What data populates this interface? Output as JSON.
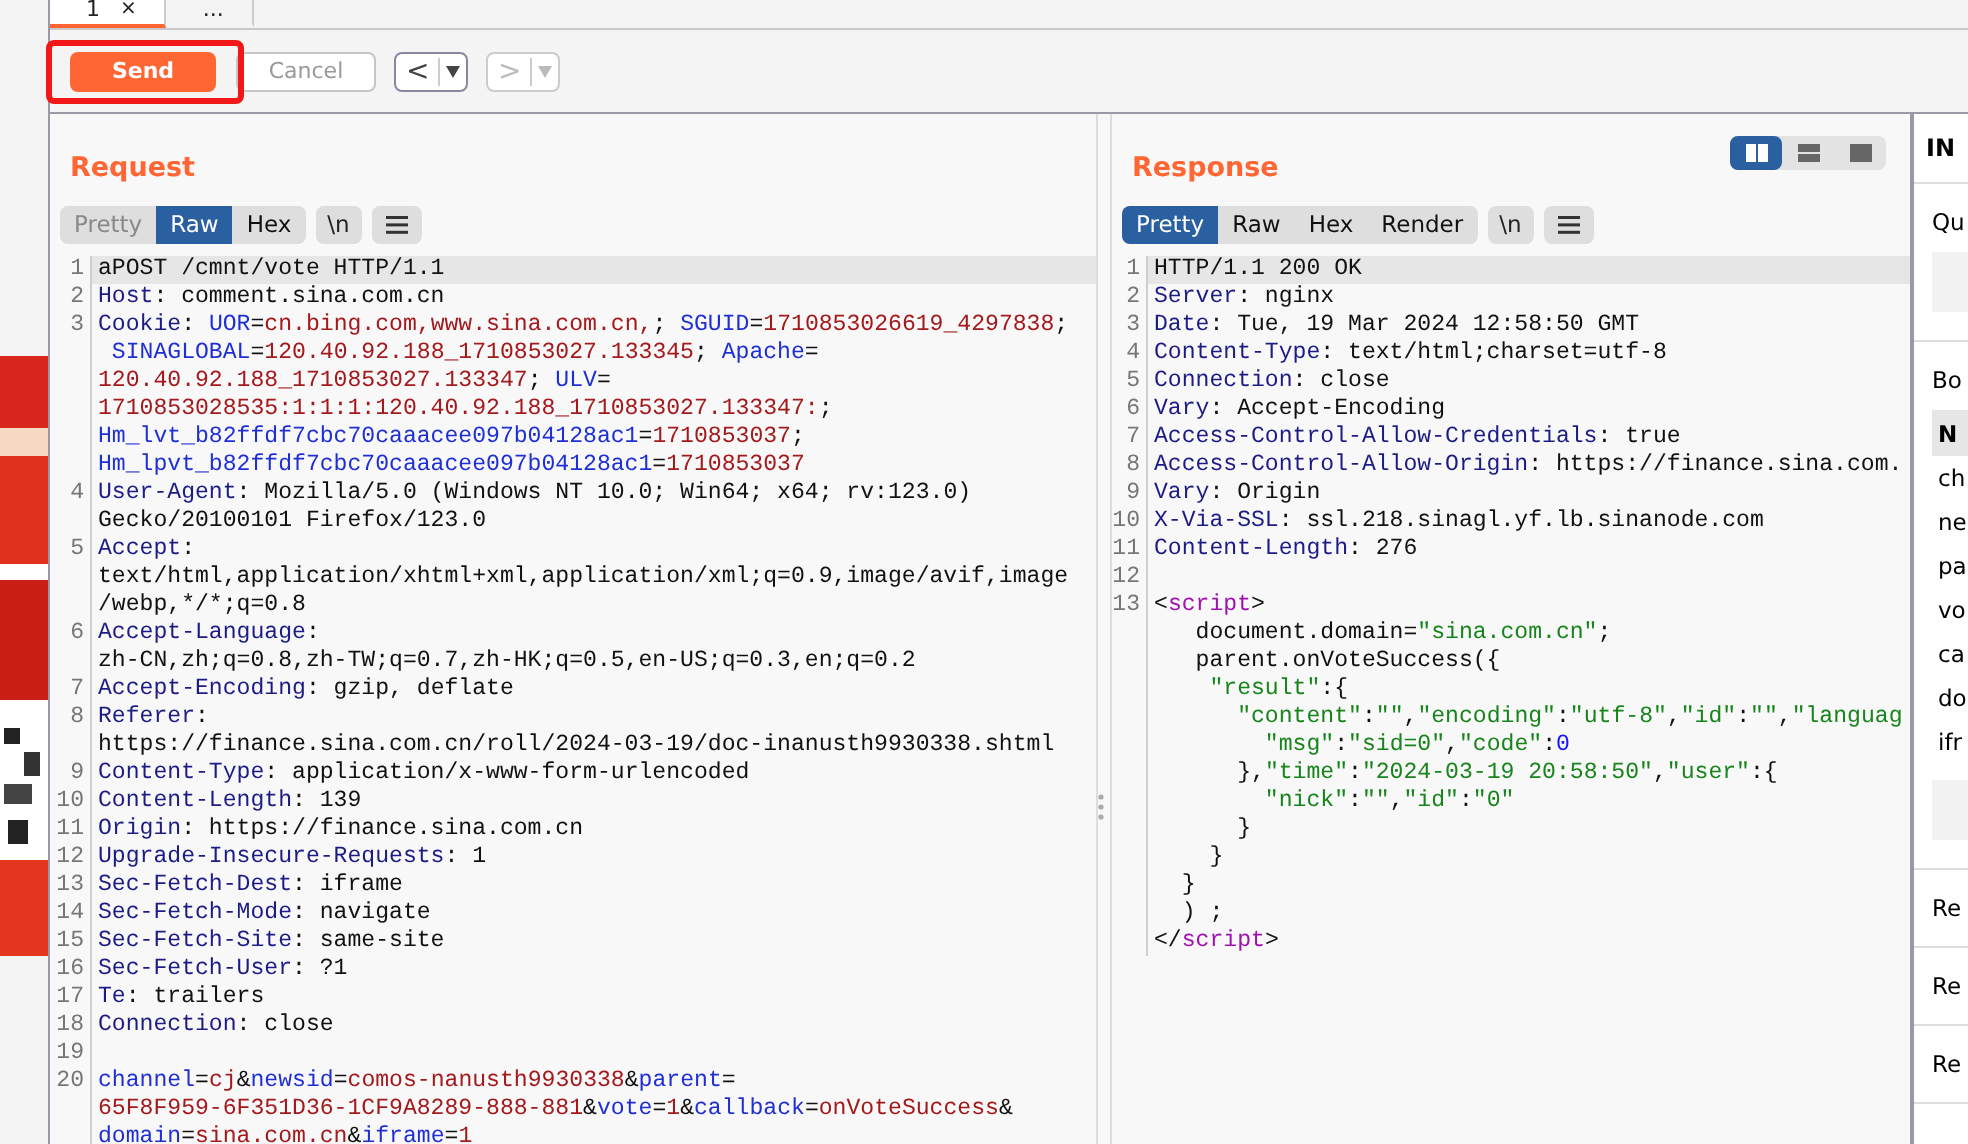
{
  "top_tabs": [
    {
      "label": "1",
      "close": "×",
      "selected": true
    },
    {
      "label": "...",
      "selected": false
    }
  ],
  "toolbar": {
    "send": {
      "label": "Send",
      "highlighted": true
    },
    "cancel": {
      "label": "Cancel",
      "disabled": true
    },
    "back": {
      "label": "<",
      "disabled": false
    },
    "forward": {
      "label": ">",
      "disabled": true
    }
  },
  "request": {
    "title": "Request",
    "view_tabs": [
      {
        "label": "Pretty",
        "selected": false,
        "disabled": true
      },
      {
        "label": "Raw",
        "selected": true,
        "disabled": false
      },
      {
        "label": "Hex",
        "selected": false,
        "disabled": false
      }
    ],
    "extra_buttons": [
      {
        "kind": "newline",
        "label": "\\n"
      },
      {
        "kind": "menu"
      }
    ],
    "rows": [
      {
        "line_number": "1",
        "highlighted": true,
        "parts": [
          {
            "kind": "plain",
            "text": "aPOST /cmnt/vote HTTP/1.1"
          }
        ]
      },
      {
        "line_number": "2",
        "highlighted": false,
        "parts": [
          {
            "kind": "key",
            "text": "Host"
          },
          {
            "kind": "plain",
            "text": ": comment.sina.com.cn"
          }
        ]
      },
      {
        "line_number": "3",
        "highlighted": false,
        "parts": [
          {
            "kind": "key",
            "text": "Cookie"
          },
          {
            "kind": "plain",
            "text": ": "
          },
          {
            "kind": "name",
            "text": "UOR"
          },
          {
            "kind": "plain",
            "text": "="
          },
          {
            "kind": "val",
            "text": "cn.bing.com,www.sina.com.cn,"
          },
          {
            "kind": "plain",
            "text": "; "
          },
          {
            "kind": "name",
            "text": "SGUID"
          },
          {
            "kind": "plain",
            "text": "="
          },
          {
            "kind": "val",
            "text": "1710853026619_4297838"
          },
          {
            "kind": "plain",
            "text": ";"
          }
        ]
      },
      {
        "highlighted": false,
        "parts": [
          {
            "kind": "name",
            "text": " SINAGLOBAL"
          },
          {
            "kind": "plain",
            "text": "="
          },
          {
            "kind": "val",
            "text": "120.40.92.188_1710853027.133345"
          },
          {
            "kind": "plain",
            "text": "; "
          },
          {
            "kind": "name",
            "text": "Apache"
          },
          {
            "kind": "plain",
            "text": "="
          }
        ]
      },
      {
        "highlighted": false,
        "parts": [
          {
            "kind": "val",
            "text": "120.40.92.188_1710853027.133347"
          },
          {
            "kind": "plain",
            "text": "; "
          },
          {
            "kind": "name",
            "text": "ULV"
          },
          {
            "kind": "plain",
            "text": "="
          }
        ]
      },
      {
        "highlighted": false,
        "parts": [
          {
            "kind": "val",
            "text": "1710853028535:1:1:1:120.40.92.188_1710853027.133347:"
          },
          {
            "kind": "plain",
            "text": ";"
          }
        ]
      },
      {
        "highlighted": false,
        "parts": [
          {
            "kind": "name",
            "text": "Hm_lvt_b82ffdf7cbc70caaacee097b04128ac1"
          },
          {
            "kind": "plain",
            "text": "="
          },
          {
            "kind": "val",
            "text": "1710853037"
          },
          {
            "kind": "plain",
            "text": ";"
          }
        ]
      },
      {
        "highlighted": false,
        "parts": [
          {
            "kind": "name",
            "text": "Hm_lpvt_b82ffdf7cbc70caaacee097b04128ac1"
          },
          {
            "kind": "plain",
            "text": "="
          },
          {
            "kind": "val",
            "text": "1710853037"
          }
        ]
      },
      {
        "line_number": "4",
        "highlighted": false,
        "parts": [
          {
            "kind": "key",
            "text": "User-Agent"
          },
          {
            "kind": "plain",
            "text": ": Mozilla/5.0 (Windows NT 10.0; Win64; x64; rv:123.0)"
          }
        ]
      },
      {
        "highlighted": false,
        "parts": [
          {
            "kind": "plain",
            "text": "Gecko/20100101 Firefox/123.0"
          }
        ]
      },
      {
        "line_number": "5",
        "highlighted": false,
        "parts": [
          {
            "kind": "key",
            "text": "Accept"
          },
          {
            "kind": "plain",
            "text": ":"
          }
        ]
      },
      {
        "highlighted": false,
        "parts": [
          {
            "kind": "plain",
            "text": "text/html,application/xhtml+xml,application/xml;q=0.9,image/avif,image"
          }
        ]
      },
      {
        "highlighted": false,
        "parts": [
          {
            "kind": "plain",
            "text": "/webp,*/*;q=0.8"
          }
        ]
      },
      {
        "line_number": "6",
        "highlighted": false,
        "parts": [
          {
            "kind": "key",
            "text": "Accept-Language"
          },
          {
            "kind": "plain",
            "text": ":"
          }
        ]
      },
      {
        "highlighted": false,
        "parts": [
          {
            "kind": "plain",
            "text": "zh-CN,zh;q=0.8,zh-TW;q=0.7,zh-HK;q=0.5,en-US;q=0.3,en;q=0.2"
          }
        ]
      },
      {
        "line_number": "7",
        "highlighted": false,
        "parts": [
          {
            "kind": "key",
            "text": "Accept-Encoding"
          },
          {
            "kind": "plain",
            "text": ": gzip, deflate"
          }
        ]
      },
      {
        "line_number": "8",
        "highlighted": false,
        "parts": [
          {
            "kind": "key",
            "text": "Referer"
          },
          {
            "kind": "plain",
            "text": ":"
          }
        ]
      },
      {
        "highlighted": false,
        "parts": [
          {
            "kind": "plain",
            "text": "https://finance.sina.com.cn/roll/2024-03-19/doc-inanusth9930338.shtml"
          }
        ]
      },
      {
        "line_number": "9",
        "highlighted": false,
        "parts": [
          {
            "kind": "key",
            "text": "Content-Type"
          },
          {
            "kind": "plain",
            "text": ": application/x-www-form-urlencoded"
          }
        ]
      },
      {
        "line_number": "10",
        "highlighted": false,
        "parts": [
          {
            "kind": "key",
            "text": "Content-Length"
          },
          {
            "kind": "plain",
            "text": ": 139"
          }
        ]
      },
      {
        "line_number": "11",
        "highlighted": false,
        "parts": [
          {
            "kind": "key",
            "text": "Origin"
          },
          {
            "kind": "plain",
            "text": ": https://finance.sina.com.cn"
          }
        ]
      },
      {
        "line_number": "12",
        "highlighted": false,
        "parts": [
          {
            "kind": "key",
            "text": "Upgrade-Insecure-Requests"
          },
          {
            "kind": "plain",
            "text": ": 1"
          }
        ]
      },
      {
        "line_number": "13",
        "highlighted": false,
        "parts": [
          {
            "kind": "key",
            "text": "Sec-Fetch-Dest"
          },
          {
            "kind": "plain",
            "text": ": iframe"
          }
        ]
      },
      {
        "line_number": "14",
        "highlighted": false,
        "parts": [
          {
            "kind": "key",
            "text": "Sec-Fetch-Mode"
          },
          {
            "kind": "plain",
            "text": ": navigate"
          }
        ]
      },
      {
        "line_number": "15",
        "highlighted": false,
        "parts": [
          {
            "kind": "key",
            "text": "Sec-Fetch-Site"
          },
          {
            "kind": "plain",
            "text": ": same-site"
          }
        ]
      },
      {
        "line_number": "16",
        "highlighted": false,
        "parts": [
          {
            "kind": "key",
            "text": "Sec-Fetch-User"
          },
          {
            "kind": "plain",
            "text": ": ?1"
          }
        ]
      },
      {
        "line_number": "17",
        "highlighted": false,
        "parts": [
          {
            "kind": "key",
            "text": "Te"
          },
          {
            "kind": "plain",
            "text": ": trailers"
          }
        ]
      },
      {
        "line_number": "18",
        "highlighted": false,
        "parts": [
          {
            "kind": "key",
            "text": "Connection"
          },
          {
            "kind": "plain",
            "text": ": close"
          }
        ]
      },
      {
        "line_number": "19",
        "highlighted": false
      },
      {
        "line_number": "20",
        "highlighted": false,
        "parts": [
          {
            "kind": "name",
            "text": "channel"
          },
          {
            "kind": "plain",
            "text": "="
          },
          {
            "kind": "val",
            "text": "cj"
          },
          {
            "kind": "plain",
            "text": "&"
          },
          {
            "kind": "name",
            "text": "newsid"
          },
          {
            "kind": "plain",
            "text": "="
          },
          {
            "kind": "val",
            "text": "comos-nanusth9930338"
          },
          {
            "kind": "plain",
            "text": "&"
          },
          {
            "kind": "name",
            "text": "parent"
          },
          {
            "kind": "plain",
            "text": "="
          }
        ]
      },
      {
        "highlighted": false,
        "parts": [
          {
            "kind": "val",
            "text": "65F8F959-6F351D36-1CF9A8289-888-881"
          },
          {
            "kind": "plain",
            "text": "&"
          },
          {
            "kind": "name",
            "text": "vote"
          },
          {
            "kind": "plain",
            "text": "="
          },
          {
            "kind": "val",
            "text": "1"
          },
          {
            "kind": "plain",
            "text": "&"
          },
          {
            "kind": "name",
            "text": "callback"
          },
          {
            "kind": "plain",
            "text": "="
          },
          {
            "kind": "val",
            "text": "onVoteSuccess"
          },
          {
            "kind": "plain",
            "text": "&"
          }
        ]
      },
      {
        "highlighted": false,
        "parts": [
          {
            "kind": "name",
            "text": "domain"
          },
          {
            "kind": "plain",
            "text": "="
          },
          {
            "kind": "val",
            "text": "sina.com.cn"
          },
          {
            "kind": "plain",
            "text": "&"
          },
          {
            "kind": "name",
            "text": "iframe"
          },
          {
            "kind": "plain",
            "text": "="
          },
          {
            "kind": "val",
            "text": "1"
          }
        ]
      }
    ]
  },
  "response": {
    "title": "Response",
    "layout_buttons": [
      {
        "kind": "columns",
        "selected": true
      },
      {
        "kind": "rows",
        "selected": false
      },
      {
        "kind": "single",
        "selected": false
      }
    ],
    "view_tabs": [
      {
        "label": "Pretty",
        "selected": true,
        "disabled": false
      },
      {
        "label": "Raw",
        "selected": false,
        "disabled": false
      },
      {
        "label": "Hex",
        "selected": false,
        "disabled": false
      },
      {
        "label": "Render",
        "selected": false,
        "disabled": false
      }
    ],
    "extra_buttons": [
      {
        "kind": "newline",
        "label": "\\n"
      },
      {
        "kind": "menu"
      }
    ],
    "rows": [
      {
        "line_number": "1",
        "highlighted": true,
        "parts": [
          {
            "kind": "plain",
            "text": "HTTP/1.1 200 OK"
          }
        ]
      },
      {
        "line_number": "2",
        "highlighted": false,
        "parts": [
          {
            "kind": "key",
            "text": "Server"
          },
          {
            "kind": "plain",
            "text": ": nginx"
          }
        ]
      },
      {
        "line_number": "3",
        "highlighted": false,
        "parts": [
          {
            "kind": "key",
            "text": "Date"
          },
          {
            "kind": "plain",
            "text": ": Tue, 19 Mar 2024 12:58:50 GMT"
          }
        ]
      },
      {
        "line_number": "4",
        "highlighted": false,
        "parts": [
          {
            "kind": "key",
            "text": "Content-Type"
          },
          {
            "kind": "plain",
            "text": ": text/html;charset=utf-8"
          }
        ]
      },
      {
        "line_number": "5",
        "highlighted": false,
        "parts": [
          {
            "kind": "key",
            "text": "Connection"
          },
          {
            "kind": "plain",
            "text": ": close"
          }
        ]
      },
      {
        "line_number": "6",
        "highlighted": false,
        "parts": [
          {
            "kind": "key",
            "text": "Vary"
          },
          {
            "kind": "plain",
            "text": ": Accept-Encoding"
          }
        ]
      },
      {
        "line_number": "7",
        "highlighted": false,
        "parts": [
          {
            "kind": "key",
            "text": "Access-Control-Allow-Credentials"
          },
          {
            "kind": "plain",
            "text": ": true"
          }
        ]
      },
      {
        "line_number": "8",
        "highlighted": false,
        "parts": [
          {
            "kind": "key",
            "text": "Access-Control-Allow-Origin"
          },
          {
            "kind": "plain",
            "text": ": https://finance.sina.com."
          }
        ]
      },
      {
        "line_number": "9",
        "highlighted": false,
        "parts": [
          {
            "kind": "key",
            "text": "Vary"
          },
          {
            "kind": "plain",
            "text": ": Origin"
          }
        ]
      },
      {
        "line_number": "10",
        "highlighted": false,
        "parts": [
          {
            "kind": "key",
            "text": "X-Via-SSL"
          },
          {
            "kind": "plain",
            "text": ": ssl.218.sinagl.yf.lb.sinanode.com"
          }
        ]
      },
      {
        "line_number": "11",
        "highlighted": false,
        "parts": [
          {
            "kind": "key",
            "text": "Content-Length"
          },
          {
            "kind": "plain",
            "text": ": 276"
          }
        ]
      },
      {
        "line_number": "12",
        "highlighted": false
      },
      {
        "line_number": "13",
        "highlighted": false,
        "parts": [
          {
            "kind": "plain",
            "text": "<"
          },
          {
            "kind": "tag",
            "text": "script"
          },
          {
            "kind": "plain",
            "text": ">"
          }
        ]
      },
      {
        "highlighted": false,
        "parts": [
          {
            "kind": "plain",
            "text": "   document.domain="
          },
          {
            "kind": "str",
            "text": "\"sina.com.cn\""
          },
          {
            "kind": "plain",
            "text": ";"
          }
        ]
      },
      {
        "highlighted": false,
        "parts": [
          {
            "kind": "plain",
            "text": "   parent.onVoteSuccess({"
          }
        ]
      },
      {
        "highlighted": false,
        "parts": [
          {
            "kind": "str",
            "text": "    \"result\""
          },
          {
            "kind": "plain",
            "text": ":{"
          }
        ]
      },
      {
        "highlighted": false,
        "parts": [
          {
            "kind": "str",
            "text": "      \"content\""
          },
          {
            "kind": "plain",
            "text": ":"
          },
          {
            "kind": "str",
            "text": "\"\""
          },
          {
            "kind": "plain",
            "text": ","
          },
          {
            "kind": "str",
            "text": "\"encoding\""
          },
          {
            "kind": "plain",
            "text": ":"
          },
          {
            "kind": "str",
            "text": "\"utf-8\""
          },
          {
            "kind": "plain",
            "text": ","
          },
          {
            "kind": "str",
            "text": "\"id\""
          },
          {
            "kind": "plain",
            "text": ":"
          },
          {
            "kind": "str",
            "text": "\"\""
          },
          {
            "kind": "plain",
            "text": ","
          },
          {
            "kind": "str",
            "text": "\"languag"
          }
        ]
      },
      {
        "highlighted": false,
        "parts": [
          {
            "kind": "str",
            "text": "        \"msg\""
          },
          {
            "kind": "plain",
            "text": ":"
          },
          {
            "kind": "str",
            "text": "\"sid=0\""
          },
          {
            "kind": "plain",
            "text": ","
          },
          {
            "kind": "str",
            "text": "\"code\""
          },
          {
            "kind": "plain",
            "text": ":"
          },
          {
            "kind": "num",
            "text": "0"
          }
        ]
      },
      {
        "highlighted": false,
        "parts": [
          {
            "kind": "plain",
            "text": "      },"
          },
          {
            "kind": "str",
            "text": "\"time\""
          },
          {
            "kind": "plain",
            "text": ":"
          },
          {
            "kind": "str",
            "text": "\"2024-03-19 20:58:50\""
          },
          {
            "kind": "plain",
            "text": ","
          },
          {
            "kind": "str",
            "text": "\"user\""
          },
          {
            "kind": "plain",
            "text": ":{"
          }
        ]
      },
      {
        "highlighted": false,
        "parts": [
          {
            "kind": "str",
            "text": "        \"nick\""
          },
          {
            "kind": "plain",
            "text": ":"
          },
          {
            "kind": "str",
            "text": "\"\""
          },
          {
            "kind": "plain",
            "text": ","
          },
          {
            "kind": "str",
            "text": "\"id\""
          },
          {
            "kind": "plain",
            "text": ":"
          },
          {
            "kind": "str",
            "text": "\"0\""
          }
        ]
      },
      {
        "highlighted": false,
        "parts": [
          {
            "kind": "plain",
            "text": "      }"
          }
        ]
      },
      {
        "highlighted": false,
        "parts": [
          {
            "kind": "plain",
            "text": "    }"
          }
        ]
      },
      {
        "highlighted": false,
        "parts": [
          {
            "kind": "plain",
            "text": "  }"
          }
        ]
      },
      {
        "highlighted": false,
        "parts": [
          {
            "kind": "plain",
            "text": "  ) ;"
          }
        ]
      },
      {
        "highlighted": false,
        "parts": [
          {
            "kind": "plain",
            "text": "</"
          },
          {
            "kind": "tag",
            "text": "script"
          },
          {
            "kind": "plain",
            "text": ">"
          }
        ]
      }
    ]
  },
  "inspector": {
    "title": "IN",
    "query_label": "Qu",
    "body_label": "Bo",
    "table_header": "N",
    "table_rows": [
      "ch",
      "ne",
      "pa",
      "vo",
      "ca",
      "do",
      "ifr"
    ],
    "sections": [
      "Re",
      "Re",
      "Re"
    ]
  }
}
